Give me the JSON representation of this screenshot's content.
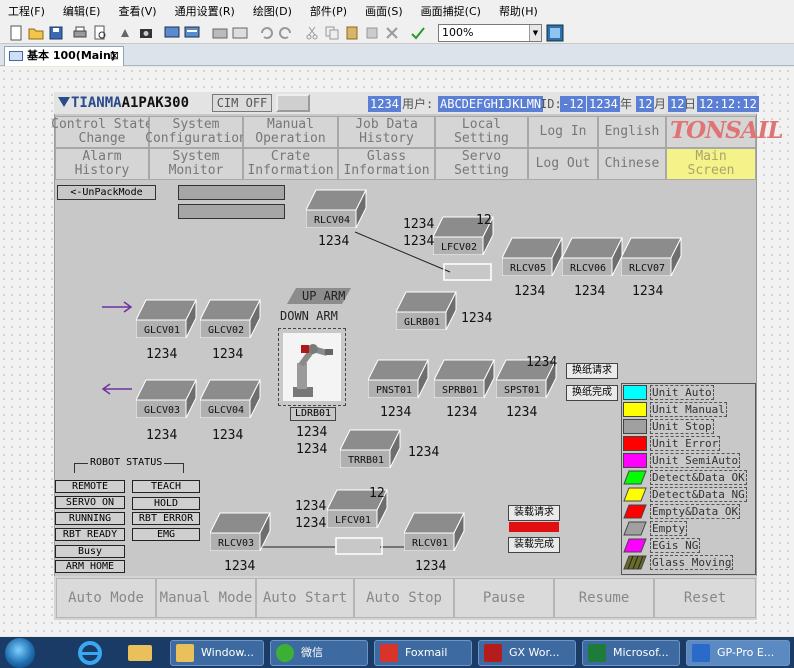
{
  "menu": [
    "工程(F)",
    "编辑(E)",
    "查看(V)",
    "通用设置(R)",
    "绘图(D)",
    "部件(P)",
    "画面(S)",
    "画面捕捉(C)",
    "帮助(H)"
  ],
  "toolbar": {
    "zoom_value": "100%"
  },
  "doc_tab": {
    "label": "基本 100(Main)",
    "close": "⊠"
  },
  "header": {
    "brand": "TIANMA",
    "model": "A1PAK300",
    "cim_status": "CIM OFF",
    "user_code": "1234",
    "user_label": "用户:",
    "user_name": "ABCDEFGHIJKLMN",
    "id_label": "ID:",
    "id_value": "-12",
    "year": "1234",
    "year_unit": "年",
    "month": "12",
    "month_unit": "月",
    "day": "12",
    "day_unit": "日",
    "time": "12:12:12"
  },
  "nav": {
    "row1": [
      "Control State\nChange",
      "System\nConfiguration",
      "Manual\nOperation",
      "Job Data\nHistory",
      "Local\nSetting",
      "Log In",
      "English"
    ],
    "row2": [
      "Alarm\nHistory",
      "System\nMonitor",
      "Crate\nInformation",
      "Glass\nInformation",
      "Servo\nSetting",
      "Log Out",
      "Chinese",
      "Main\nScreen"
    ],
    "brand_logo": "TONSAIL"
  },
  "unpack_mode": "<-UnPackMode",
  "arrows": {
    "in": "→",
    "out": "←"
  },
  "units": {
    "rlcv04": {
      "label": "RLCV04",
      "value": "1234"
    },
    "lfcv02": {
      "label": "LFCV02",
      "top_value": "12",
      "value_a": "1234",
      "value_b": "1234"
    },
    "rlcv05": {
      "label": "RLCV05",
      "value": "1234"
    },
    "rlcv06": {
      "label": "RLCV06",
      "value": "1234"
    },
    "rlcv07": {
      "label": "RLCV07",
      "value": "1234"
    },
    "glcv01": {
      "label": "GLCV01",
      "value": "1234"
    },
    "glcv02": {
      "label": "GLCV02",
      "value": "1234"
    },
    "glcv03": {
      "label": "GLCV03",
      "value": "1234"
    },
    "glcv04": {
      "label": "GLCV04",
      "value": "1234"
    },
    "glrb01": {
      "label": "GLRB01",
      "value": "1234"
    },
    "pnst01": {
      "label": "PNST01",
      "value": "1234"
    },
    "sprb01": {
      "label": "SPRB01",
      "value": "1234"
    },
    "spst01": {
      "label": "SPST01",
      "top_value": "1234",
      "value": "1234"
    },
    "trrb01": {
      "label": "TRRB01",
      "value": "1234"
    },
    "lfcv01": {
      "label": "LFCV01",
      "top_value": "12",
      "value_a": "1234",
      "value_b": "1234"
    },
    "rlcv03": {
      "label": "RLCV03",
      "value": "1234"
    },
    "rlcv01": {
      "label": "RLCV01",
      "value": "1234"
    }
  },
  "arm": {
    "up": "UP ARM",
    "down": "DOWN ARM",
    "label": "LDRB01",
    "value_a": "1234",
    "value_b": "1234"
  },
  "paper_buttons": {
    "request": "换纸请求",
    "done": "换纸完成"
  },
  "load_buttons": {
    "request": "装载请求",
    "done": "装载完成"
  },
  "robot_status": {
    "title": "ROBOT STATUS",
    "left": [
      "REMOTE",
      "SERVO ON",
      "RUNNING",
      "RBT READY",
      "Busy",
      "ARM HOME"
    ],
    "right": [
      "TEACH",
      "HOLD",
      "RBT ERROR",
      "EMG"
    ]
  },
  "legend": [
    {
      "label": "Unit Auto",
      "color": "#00ffff"
    },
    {
      "label": "Unit Manual",
      "color": "#ffff00"
    },
    {
      "label": "Unit Stop",
      "color": "#a0a0a0"
    },
    {
      "label": "Unit Error",
      "color": "#ff0000"
    },
    {
      "label": "Unit SemiAuto",
      "color": "#ff00ff"
    },
    {
      "label": "Detect&Data OK",
      "color": "#00ff00"
    },
    {
      "label": "Detect&Data NG",
      "color": "#ffff00"
    },
    {
      "label": "Empty&Data OK",
      "color": "#ff0000"
    },
    {
      "label": "Empty",
      "color": "#a0a0a0"
    },
    {
      "label": "EGis NG",
      "color": "#ff00ff"
    },
    {
      "label": "Glass Moving",
      "color": "#6b6b2a"
    }
  ],
  "bottom": [
    "Auto Mode",
    "Manual Mode",
    "Auto Start",
    "Auto Stop",
    "Pause",
    "Resume",
    "Reset"
  ],
  "taskbar": [
    "Window...",
    "微信",
    "Foxmail",
    "GX Wor...",
    "Microsof...",
    "GP-Pro E..."
  ]
}
